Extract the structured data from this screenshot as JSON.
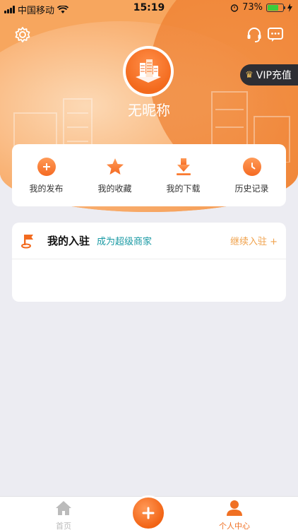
{
  "status_bar": {
    "carrier": "中国移动",
    "time": "15:19",
    "battery": "73%",
    "battery_level": 0.73
  },
  "header": {
    "nickname": "无昵称",
    "vip_label": "VIP充值",
    "icons": [
      "gear-icon",
      "headset-icon",
      "chat-icon"
    ],
    "colors": {
      "accent": "#F36A1D",
      "light": "#F9B478",
      "vip_bg": "#2E2E33",
      "vip_crown": "#F4C45A"
    }
  },
  "shortcuts": [
    {
      "label": "我的发布",
      "icon": "plus-circle-icon"
    },
    {
      "label": "我的收藏",
      "icon": "star-icon"
    },
    {
      "label": "我的下载",
      "icon": "download-icon"
    },
    {
      "label": "历史记录",
      "icon": "clock-icon"
    }
  ],
  "merchant": {
    "title": "我的入驻",
    "subtitle": "成为超级商家",
    "action": "继续入驻 +",
    "colors": {
      "subtitle": "#1A9AA4",
      "action": "#F0A24C"
    }
  },
  "tabbar": {
    "items": [
      {
        "label": "首页",
        "icon": "home-icon",
        "active": false
      },
      {
        "label": "个人中心",
        "icon": "person-icon",
        "active": true
      }
    ],
    "center_button": "plus-icon"
  }
}
